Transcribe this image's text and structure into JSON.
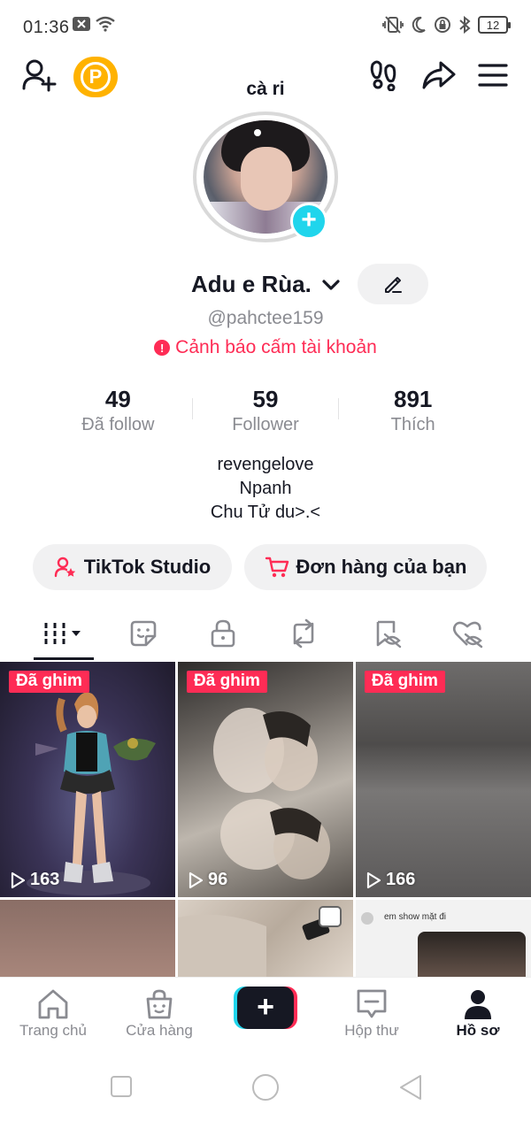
{
  "status_bar": {
    "time": "01:36",
    "battery": "12"
  },
  "header": {
    "nickname": "cà ri",
    "p_badge": "P"
  },
  "profile": {
    "display_name": "Adu e Rùa.",
    "username": "@pahctee159",
    "warning": "Cảnh báo cấm tài khoản",
    "warning_icon": "!",
    "add_symbol": "+"
  },
  "stats": [
    {
      "value": "49",
      "label": "Đã follow"
    },
    {
      "value": "59",
      "label": "Follower"
    },
    {
      "value": "891",
      "label": "Thích"
    }
  ],
  "bio": [
    "revengelove",
    "Npanh",
    "Chu Tử du>.<"
  ],
  "actions": {
    "studio": "TikTok Studio",
    "orders": "Đơn hàng của bạn"
  },
  "grid": {
    "pinned_label": "Đã ghim",
    "videos": [
      {
        "views": "163",
        "pinned": true
      },
      {
        "views": "96",
        "pinned": true
      },
      {
        "views": "166",
        "pinned": true
      }
    ],
    "comment_text": "em show mặt đi"
  },
  "bottom_nav": {
    "home": "Trang chủ",
    "shop": "Cửa hàng",
    "create": "+",
    "inbox": "Hộp thư",
    "profile": "Hồ sơ"
  },
  "colors": {
    "accent": "#fe2c55",
    "cyan": "#20d5ec",
    "badge": "#ffb200"
  }
}
